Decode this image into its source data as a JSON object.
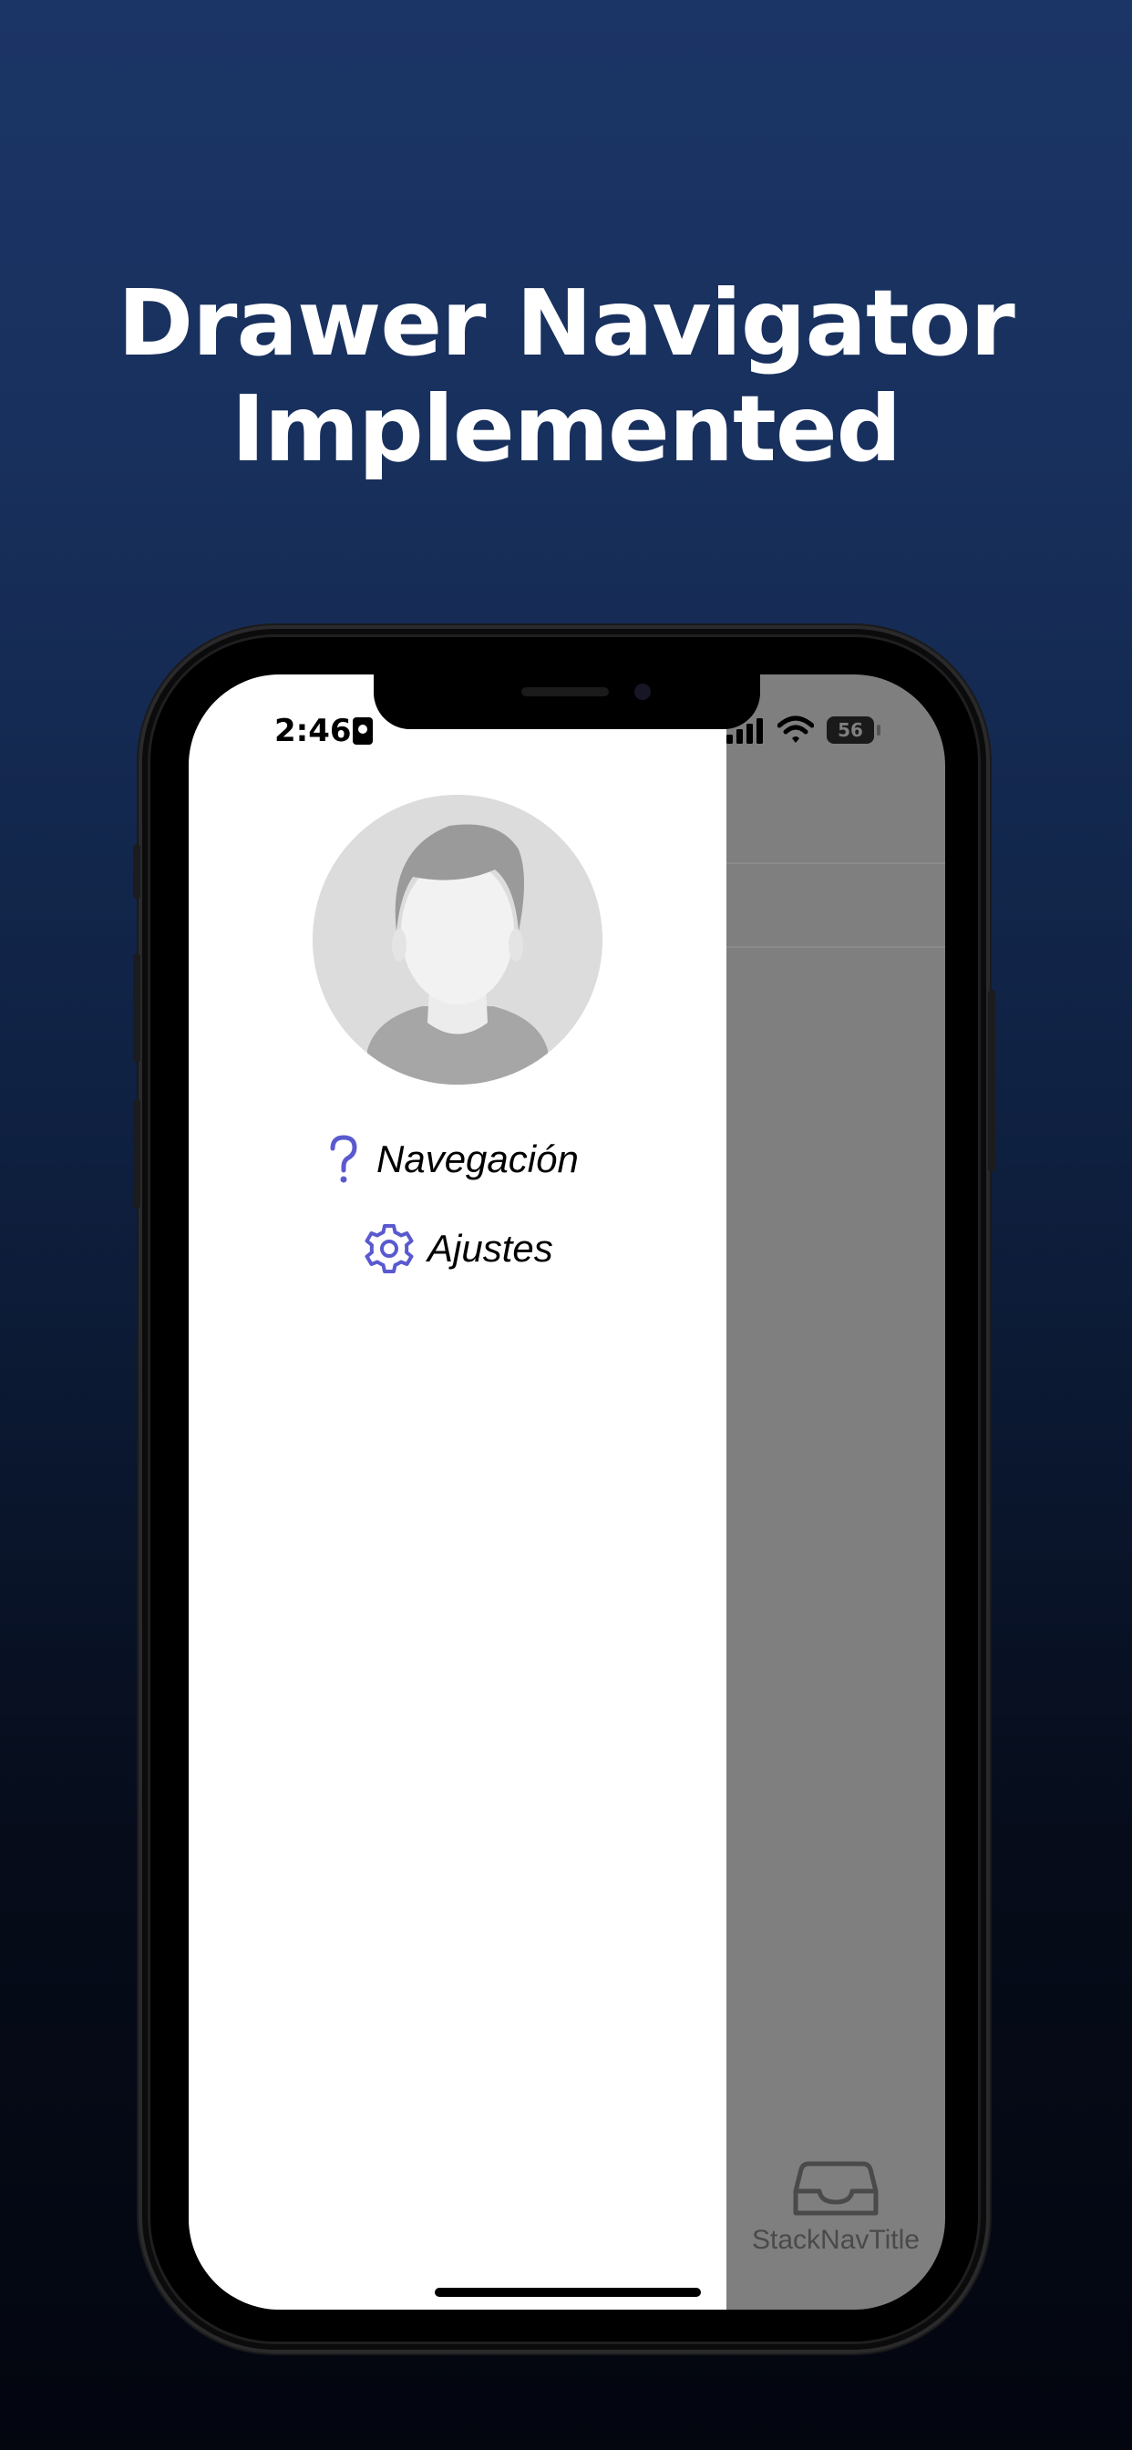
{
  "headline": {
    "line1": "Drawer Navigator",
    "line2": "Implemented"
  },
  "status_bar": {
    "time": "2:46",
    "battery_level": "56"
  },
  "drawer": {
    "items": [
      {
        "label": "Navegación",
        "icon": "question-mark-icon"
      },
      {
        "label": "Ajustes",
        "icon": "gear-icon"
      }
    ]
  },
  "tab_bar": {
    "items": [
      {
        "label": "StackNavTitle",
        "icon": "inbox-tray-icon"
      }
    ]
  },
  "colors": {
    "accent": "#5a5acf",
    "scrim": "#7f7f7f",
    "background_top": "#1b3566",
    "background_bottom": "#03060f"
  }
}
